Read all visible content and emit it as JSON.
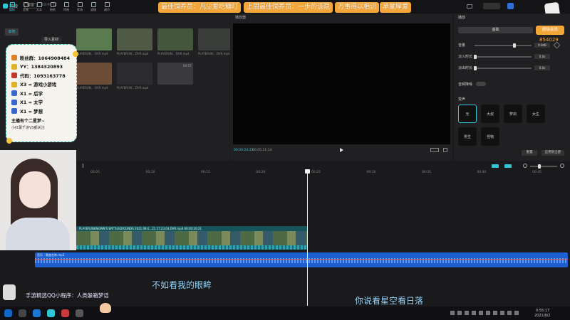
{
  "app": {
    "title": "剪映",
    "menu": "菜单",
    "time_shown": "19:46 12"
  },
  "toolbar": {
    "items": [
      "媒体",
      "音频",
      "文本",
      "贴纸",
      "特效",
      "转场",
      "滤镜",
      "调节"
    ]
  },
  "banners": [
    "最佳饲养员：凡尘爱吃糖叮",
    "上周最佳饲养员：一步的该隐",
    "万事得以相识",
    "承蒙厚爱"
  ],
  "media": {
    "tab_local": "本地",
    "import": "导入素材",
    "clips": [
      {
        "name": "PLAYERUN... DVR.mp4",
        "color": "#5a7a4f"
      },
      {
        "name": "PLAYERUN... DVR.mp4",
        "color": "#4e5a45"
      },
      {
        "name": "PLAYERUN... DVR.mp4",
        "color": "#44573a"
      },
      {
        "name": "PLAYERUN... DVR.mp4",
        "color": "#3a3d3a"
      },
      {
        "name": "PLAYERUN... DVR.mp4",
        "color": "#6b4c36"
      },
      {
        "name": "PLAYERUN... DVR.mp4",
        "color": "#2c2c2e"
      },
      {
        "name": "",
        "color": "#3a3a3c"
      }
    ],
    "audio_duration": "04:57"
  },
  "infocard": {
    "rows": [
      "粉丝群：1064908484",
      "YY：1384320893",
      "代码：1093163778",
      "X3 = 游戏小游戏",
      "X1 = 后学",
      "X1 = 太学",
      "X1 = 梦想"
    ],
    "footer1": "主播有个二星梦~",
    "footer2": "小红薯千进VS都关注"
  },
  "player": {
    "title": "播放器",
    "time_current": "00:00:24:21",
    "time_total": "00:05:21:14"
  },
  "props": {
    "header": "播放",
    "tab_basic": "基础",
    "tab_vip": "超级会员",
    "points": "854029",
    "volume_label": "音量",
    "fadein_label": "淡入时长",
    "fadeout_label": "淡出时长",
    "volume_val": "0.0dB",
    "fadein_val": "0.0s",
    "fadeout_val": "0.0s",
    "normalize_label": "音频降噪",
    "voice_label": "变声",
    "effects": [
      "无",
      "大叔",
      "萝莉",
      "女生",
      "男生",
      "怪物"
    ],
    "btn_reset": "重置",
    "btn_default": "应用到全部"
  },
  "timeline": {
    "ticks": [
      "00:05",
      "00:10",
      "00:15",
      "00:20",
      "00:25",
      "00:30",
      "00:35",
      "00:40",
      "00:45"
    ],
    "video_track_label": "PLAYERUNKNOWN'S BATTLEGROUNDS 2021.08.0...21.17.23.04.DVR.mp4  00:00:20:21",
    "audio_track_label": "音乐 - 歌曲名称.mp3"
  },
  "subtitles": {
    "left": "不如看我的眼眸",
    "right": "你说看星空看日落"
  },
  "watermark": {
    "label": "手游精选QQ小程序：人类躲箱梦话"
  },
  "taskbar": {
    "time": "0:55:17",
    "date": "2021/8/2"
  }
}
